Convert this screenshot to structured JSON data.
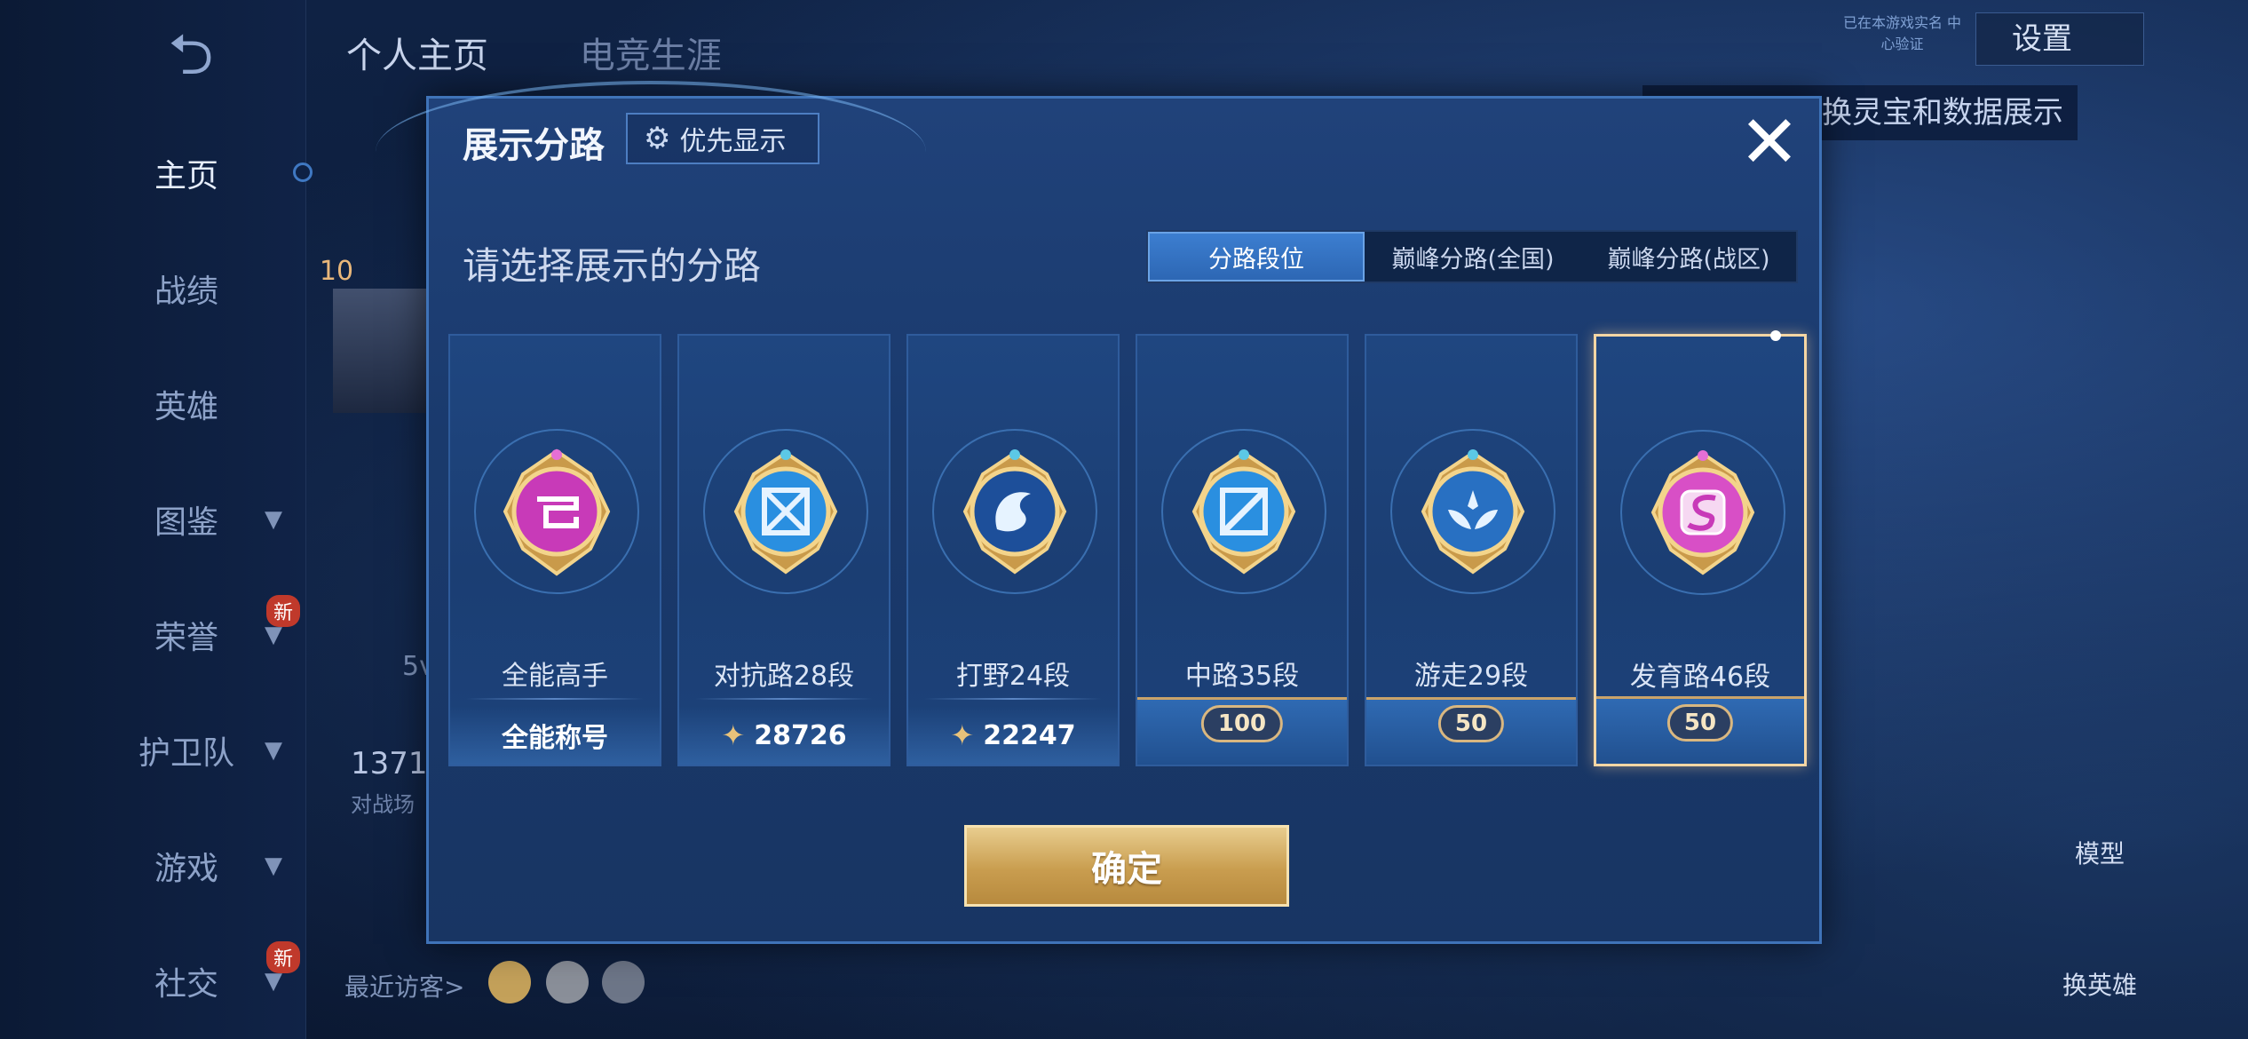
{
  "sidebar": {
    "back_icon": "back-arrow-icon",
    "items": [
      {
        "label": "主页",
        "active": true
      },
      {
        "label": "战绩"
      },
      {
        "label": "英雄"
      },
      {
        "label": "图鉴",
        "expandable": true
      },
      {
        "label": "荣誉",
        "expandable": true,
        "badge": "新"
      },
      {
        "label": "护卫队",
        "expandable": true
      },
      {
        "label": "游戏",
        "expandable": true
      },
      {
        "label": "社交",
        "expandable": true,
        "badge": "新"
      }
    ]
  },
  "background": {
    "tabs": [
      "个人主页",
      "电竞生涯"
    ],
    "level": "10",
    "settings_label": "设置",
    "realname_text": "已在本游戏实名 中心验证",
    "tip_text": "以切换灵宝和数据展示",
    "stat_number": "1371",
    "stat_label": "对战场",
    "mode_label": "5v",
    "visitors_label": "最近访客>",
    "right_labels": [
      "模型",
      "换英雄"
    ]
  },
  "modal": {
    "title": "展示分路",
    "priority_button": "优先显示",
    "close_icon": "close-icon",
    "subtitle": "请选择展示的分路",
    "tabs": [
      "分路段位",
      "巅峰分路(全国)",
      "巅峰分路(战区)"
    ],
    "active_tab": 0,
    "cards": [
      {
        "name": "全能高手",
        "bottom": "全能称号",
        "type": "title",
        "emblem_color": "#c83ab8"
      },
      {
        "name": "对抗路28段",
        "bottom": "28726",
        "type": "score",
        "emblem_color": "#2a8fe0"
      },
      {
        "name": "打野24段",
        "bottom": "22247",
        "type": "score",
        "emblem_color": "#2b6fc4"
      },
      {
        "name": "中路35段",
        "bottom": "100",
        "type": "stars",
        "emblem_color": "#2a8fe0"
      },
      {
        "name": "游走29段",
        "bottom": "50",
        "type": "stars",
        "emblem_color": "#2870c2"
      },
      {
        "name": "发育路46段",
        "bottom": "50",
        "type": "stars",
        "emblem_color": "#d84fc6",
        "selected": true
      }
    ],
    "confirm_label": "确定"
  }
}
